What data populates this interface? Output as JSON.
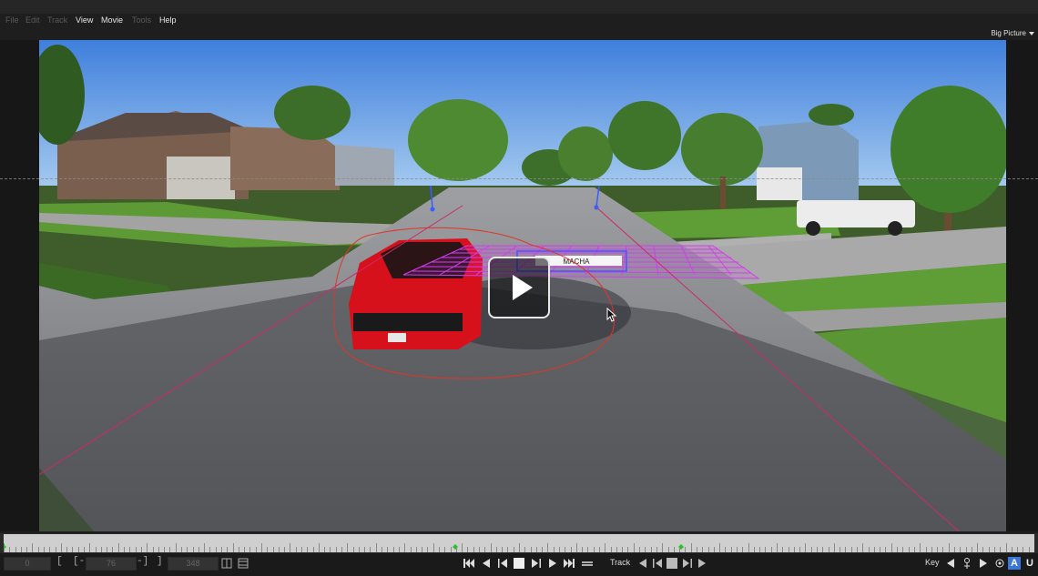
{
  "menubar": {
    "items": [
      {
        "label": "File",
        "enabled": false
      },
      {
        "label": "Edit",
        "enabled": false
      },
      {
        "label": "Track",
        "enabled": false
      },
      {
        "label": "View",
        "enabled": true
      },
      {
        "label": "Movie",
        "enabled": true
      },
      {
        "label": "Tools",
        "enabled": false
      },
      {
        "label": "Help",
        "enabled": true
      }
    ]
  },
  "view": {
    "mode_label": "Big Picture"
  },
  "viewer": {
    "plate_text": "MACHA",
    "colors": {
      "mask": "#e0352b",
      "planar_grid": "#d43cf0",
      "horizon": "#cc2a6a",
      "tracker": "#3b5cff"
    }
  },
  "timeline": {
    "keyframe_color": "#2bbf2b",
    "playhead_color": "#7a7a7a"
  },
  "controls": {
    "start_frame": "0",
    "in_frame": "76",
    "end_frame": "348",
    "track_label": "Track",
    "key_label": "Key",
    "mode_letter": "A",
    "undo_letter": "U"
  },
  "icons": [
    "play-icon",
    "cursor-icon",
    "go-start-icon",
    "step-back-icon",
    "play-backward-icon",
    "stop-icon",
    "play-forward-icon",
    "step-forward-icon",
    "go-end-icon",
    "loop-icon",
    "track-backward-icon",
    "track-step-back-icon",
    "track-stop-icon",
    "track-step-forward-icon",
    "track-forward-icon",
    "key-prev-icon",
    "key-add-icon",
    "key-next-icon",
    "key-settings-icon"
  ]
}
